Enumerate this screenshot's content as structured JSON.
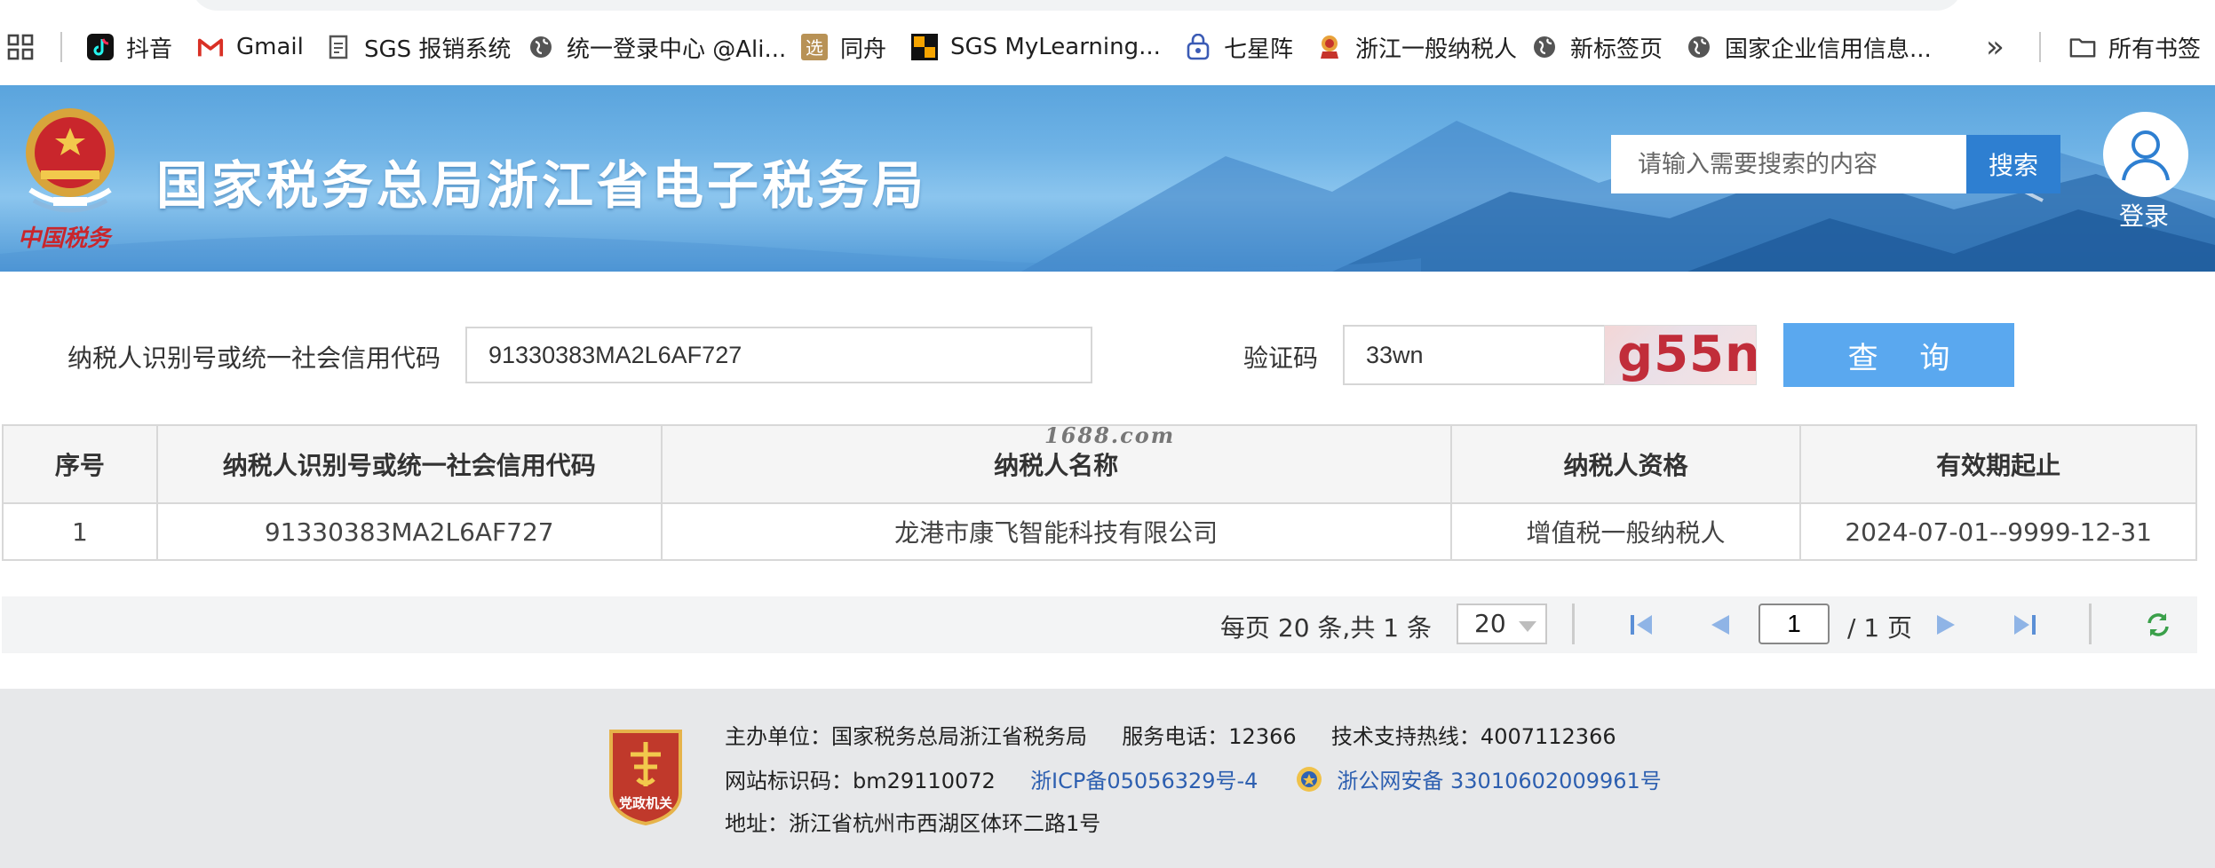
{
  "bookmarks": {
    "items": [
      {
        "label": "抖音",
        "icon": "douyin-icon"
      },
      {
        "label": "Gmail",
        "icon": "gmail-icon"
      },
      {
        "label": "SGS 报销系统",
        "icon": "document-icon"
      },
      {
        "label": "统一登录中心 @Ali...",
        "icon": "globe-icon"
      },
      {
        "label": "同舟",
        "icon": "tongzhou-icon"
      },
      {
        "label": "SGS MyLearning...",
        "icon": "sgs-icon"
      },
      {
        "label": "七星阵",
        "icon": "lock-icon"
      },
      {
        "label": "浙江一般纳税人",
        "icon": "tax-badge-icon"
      },
      {
        "label": "新标签页",
        "icon": "globe-icon"
      },
      {
        "label": "国家企业信用信息...",
        "icon": "globe-icon"
      }
    ],
    "overflow_label": "»",
    "all_bookmarks_label": "所有书签"
  },
  "header": {
    "title": "国家税务总局浙江省电子税务局",
    "emblem_text": "中国税务",
    "search_placeholder": "请输入需要搜索的内容",
    "search_button": "搜索",
    "login_label": "登录"
  },
  "query": {
    "taxpayer_id_label": "纳税人识别号或统一社会信用代码",
    "taxpayer_id_value": "91330383MA2L6AF727",
    "captcha_label": "验证码",
    "captcha_value": "33wn",
    "captcha_image_text": "g55n",
    "submit_button": "查 询"
  },
  "watermark": "1688.com",
  "table": {
    "headers": [
      "序号",
      "纳税人识别号或统一社会信用代码",
      "纳税人名称",
      "纳税人资格",
      "有效期起止"
    ],
    "rows": [
      [
        "1",
        "91330383MA2L6AF727",
        "龙港市康飞智能科技有限公司",
        "增值税一般纳税人",
        "2024-07-01--9999-12-31"
      ]
    ]
  },
  "pager": {
    "summary": "每页 20 条,共 1 条",
    "page_size": "20",
    "current_page": "1",
    "total_pages": "/ 1 页"
  },
  "footer": {
    "host_label": "主办单位：国家税务总局浙江省税务局",
    "service_phone": "服务电话：12366",
    "support_hotline": "技术支持热线：4007112366",
    "site_id": "网站标识码：bm29110072",
    "icp": "浙ICP备05056329号-4",
    "police_record": "浙公网安备 33010602009961号",
    "address": "地址：浙江省杭州市西湖区体环二路1号",
    "badge_text": "党政机关"
  },
  "colors": {
    "banner": "#5aa4dd",
    "search_button": "#2e7fd1",
    "query_button": "#5aa8ef",
    "link": "#2d5fb0",
    "captcha_text": "#c12d3a"
  }
}
